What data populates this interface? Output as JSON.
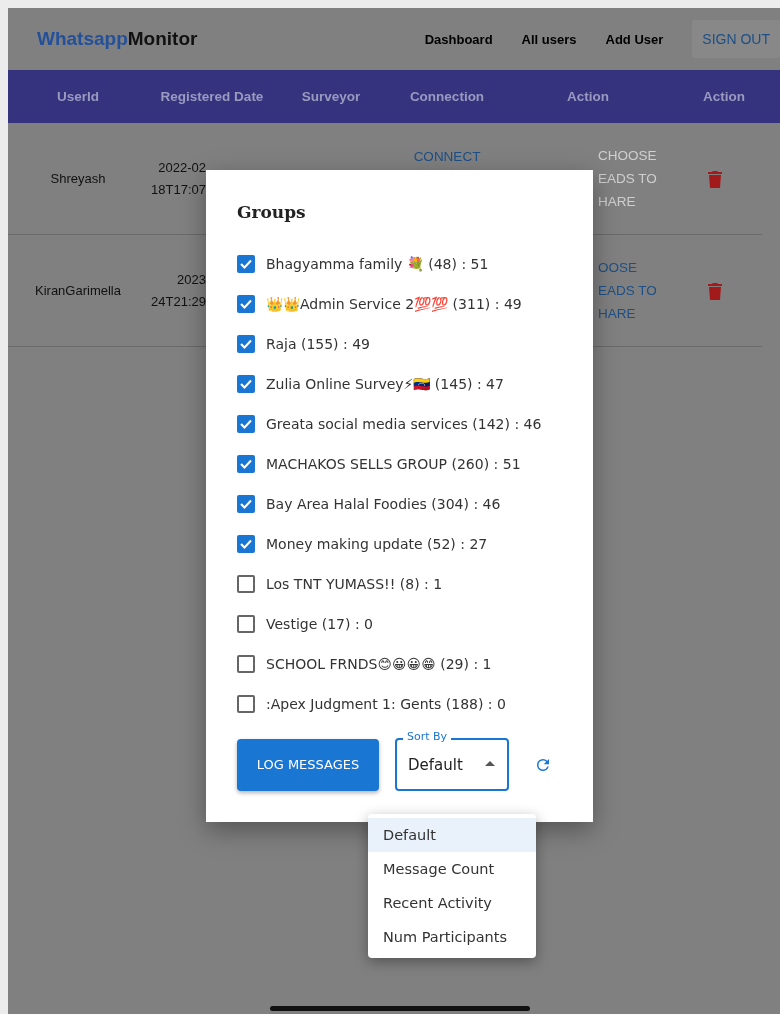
{
  "app_bar": {
    "brand": {
      "prefix": "Whatsapp",
      "suffix": "Monitor"
    },
    "nav": [
      "Dashboard",
      "All users",
      "Add User"
    ],
    "sign_out": "SIGN OUT"
  },
  "table": {
    "columns": [
      "UserId",
      "Registered Date",
      "Surveyor",
      "Connection",
      "Action",
      "Action"
    ],
    "rows": [
      {
        "user_id": "Shreyash",
        "registered_date": [
          "2022-02",
          "18T17:07"
        ],
        "connection": "CONNECT",
        "action": {
          "lines": [
            "CHOOSE",
            "EADS TO",
            "HARE"
          ],
          "disabled": true
        }
      },
      {
        "user_id": "KiranGarimella",
        "registered_date": [
          "2023",
          "24T21:29"
        ],
        "action": {
          "lines": [
            "OOSE",
            "EADS TO",
            "HARE"
          ],
          "disabled": false
        }
      }
    ]
  },
  "dialog": {
    "title": "Groups",
    "groups": [
      {
        "label": "Bhagyamma family 💐 (48) : 51",
        "checked": true
      },
      {
        "label": "👑👑Admin Service 2💯💯 (311) : 49",
        "checked": true
      },
      {
        "label": "Raja (155) : 49",
        "checked": true
      },
      {
        "label": "Zulia Online Survey⚡🇻🇪 (145) : 47",
        "checked": true
      },
      {
        "label": "Greata social media services (142) : 46",
        "checked": true
      },
      {
        "label": "MACHAKOS SELLS GROUP (260) : 51",
        "checked": true
      },
      {
        "label": "Bay Area Halal Foodies (304) : 46",
        "checked": true
      },
      {
        "label": "Money making update (52) : 27",
        "checked": true
      },
      {
        "label": "Los TNT YUMASS!! (8) : 1",
        "checked": false
      },
      {
        "label": "Vestige (17) : 0",
        "checked": false
      },
      {
        "label": "SCHOOL FRNDS😊😀😀😁 (29) : 1",
        "checked": false
      },
      {
        "label": ":Apex Judgment 1: Gents (188) : 0",
        "checked": false
      }
    ],
    "log_button": "LOG MESSAGES",
    "sort": {
      "label": "Sort By",
      "value": "Default",
      "expanded": true
    },
    "menu": [
      {
        "label": "Default",
        "selected": true
      },
      {
        "label": "Message Count",
        "selected": false
      },
      {
        "label": "Recent Activity",
        "selected": false
      },
      {
        "label": "Num Participants",
        "selected": false
      }
    ]
  }
}
